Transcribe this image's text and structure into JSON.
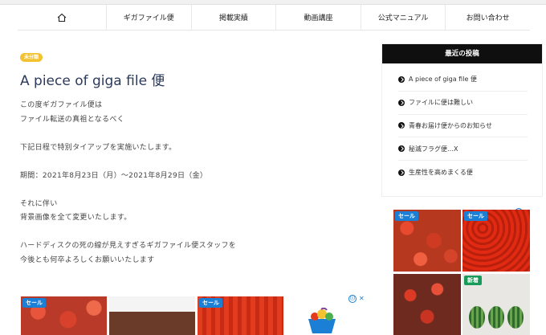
{
  "nav": {
    "home_icon": "home-icon",
    "items": [
      "ギガファイル便",
      "掲載実績",
      "動画講座",
      "公式マニュアル",
      "お問い合わせ"
    ]
  },
  "post": {
    "category": "未分類",
    "title": "A piece of giga file 便",
    "paragraphs": [
      [
        "この度ギガファイル便は",
        "ファイル転送の真祖となるべく"
      ],
      [
        "下記日程で特別タイアップを実施いたします。"
      ],
      [
        "期間：2021年8月23日（月）～2021年8月29日（金）"
      ],
      [
        "それに伴い",
        "背景画像を全て変更いたします。"
      ],
      [
        "ハードディスクの死の線が見えすぎるギガファイル便スタッフを",
        "今後とも何卒よろしくお願いいたします"
      ]
    ]
  },
  "sidebar": {
    "recent_title": "最近の投稿",
    "recent_posts": [
      "A piece of giga file 便",
      "ファイルに便は難しい",
      "青春お届け便からのお知らせ",
      "秘滅フラグ便…X",
      "生産性を高めまくる便"
    ]
  },
  "ads": {
    "sale_label": "セール",
    "new_label": "新着",
    "info_icon": "ⓘ",
    "close_icon": "✕",
    "colors": {
      "label_blue": "#1b7fd6",
      "label_green": "#1a9a5a",
      "badge_yellow": "#f2c230"
    }
  }
}
